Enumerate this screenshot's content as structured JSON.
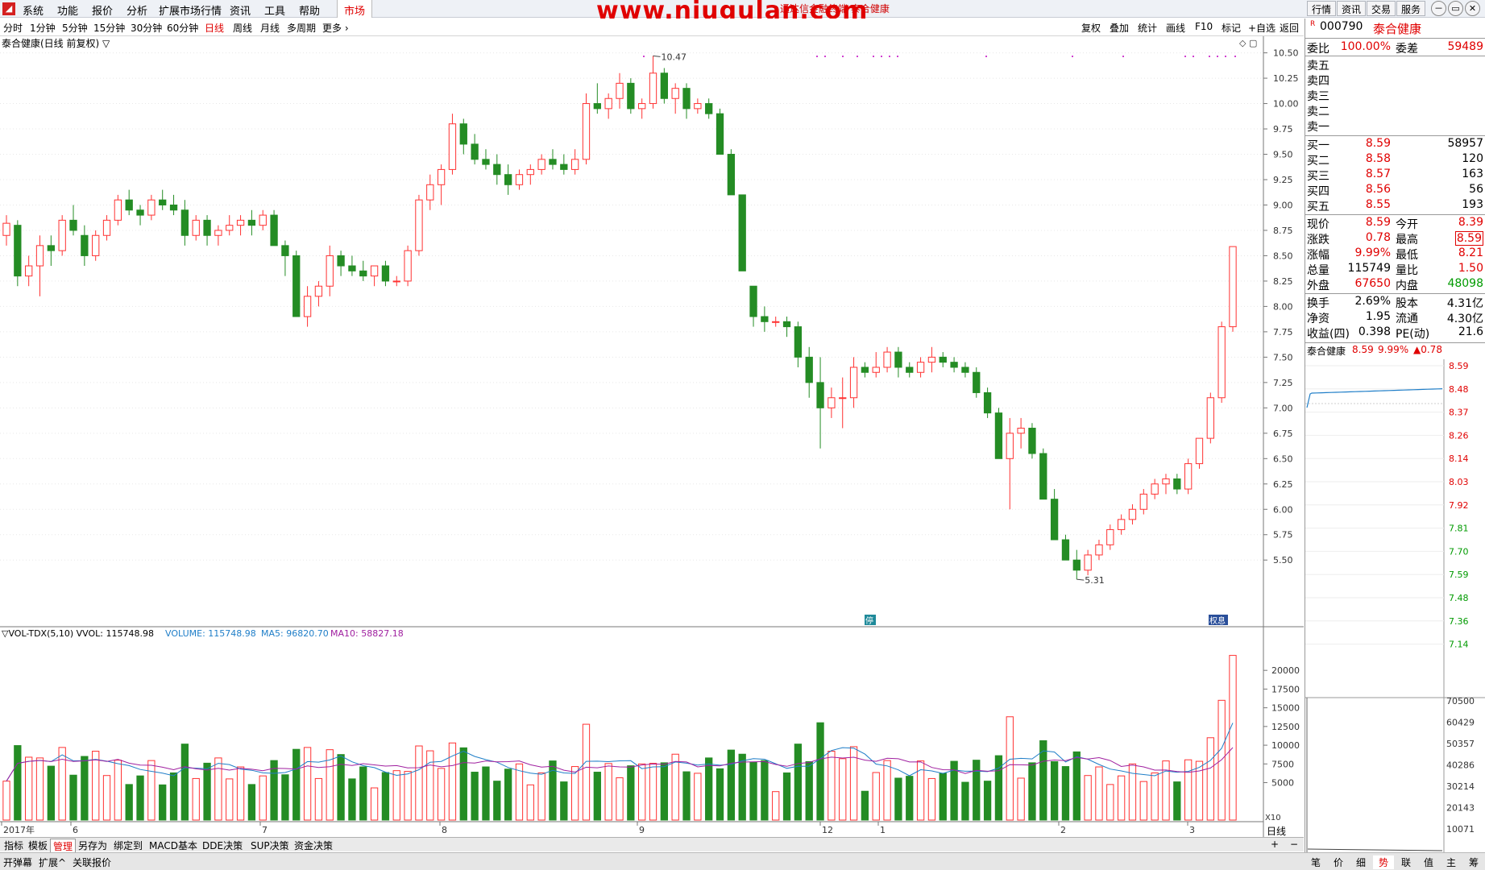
{
  "menu": [
    "系统",
    "功能",
    "报价",
    "分析",
    "扩展市场行情",
    "资讯",
    "工具",
    "帮助"
  ],
  "market_tab": "市场",
  "watermark": "www.niugulan.com",
  "window_title": "通达信金融终端 泰合健康",
  "top_buttons": [
    "行情",
    "资讯",
    "交易",
    "服务"
  ],
  "window_controls": [
    "－",
    "▭",
    "⊙",
    "✕"
  ],
  "periods": [
    "分时",
    "1分钟",
    "5分钟",
    "15分钟",
    "30分钟",
    "60分钟",
    "日线",
    "周线",
    "月线",
    "多周期",
    "更多 ›"
  ],
  "active_period": "日线",
  "tools_right": [
    "复权",
    "叠加",
    "统计",
    "画线",
    "F10",
    "标记",
    "+自选",
    "返回"
  ],
  "chart": {
    "title": "泰合健康(日线 前复权) ▽",
    "high_label": "10.47",
    "low_label": "5.31",
    "price_ticks": [
      "10.50",
      "10.25",
      "10.00",
      "9.75",
      "9.50",
      "9.25",
      "9.00",
      "8.75",
      "8.50",
      "8.25",
      "8.00",
      "7.75",
      "7.50",
      "7.25",
      "7.00",
      "6.75",
      "6.50",
      "6.25",
      "6.00",
      "5.75",
      "5.50"
    ],
    "vol_ticks": [
      "20000",
      "17500",
      "15000",
      "12500",
      "10000",
      "7500",
      "5000"
    ],
    "vol_unit": "X10",
    "vol_header_a": "▽VOL-TDX(5,10)  VVOL: 115748.98",
    "vol_header_b": "VOLUME: 115748.98",
    "vol_header_c": "MA5: 96820.70",
    "vol_header_d": "MA10: 58827.18",
    "months": [
      "2017年",
      "6",
      "7",
      "8",
      "9",
      "12",
      "1",
      "2",
      "3"
    ],
    "marker_stop": "停",
    "marker_div": "权息",
    "period_right": "日线"
  },
  "chart_data": {
    "type": "candlestick",
    "title": "泰合健康(日线 前复权)",
    "ylim": [
      5.2,
      10.6
    ],
    "annotations": {
      "high": 10.47,
      "low": 5.31
    },
    "ohlc": [
      [
        8.7,
        8.9,
        8.6,
        8.82
      ],
      [
        8.8,
        8.85,
        8.2,
        8.3
      ],
      [
        8.3,
        8.5,
        8.2,
        8.4
      ],
      [
        8.4,
        8.7,
        8.1,
        8.6
      ],
      [
        8.6,
        8.7,
        8.4,
        8.55
      ],
      [
        8.55,
        8.9,
        8.5,
        8.85
      ],
      [
        8.85,
        9.0,
        8.7,
        8.75
      ],
      [
        8.7,
        8.8,
        8.4,
        8.5
      ],
      [
        8.5,
        8.75,
        8.45,
        8.7
      ],
      [
        8.7,
        8.9,
        8.65,
        8.85
      ],
      [
        8.85,
        9.1,
        8.8,
        9.05
      ],
      [
        9.05,
        9.15,
        8.9,
        8.95
      ],
      [
        8.95,
        9.0,
        8.8,
        8.9
      ],
      [
        8.9,
        9.1,
        8.85,
        9.05
      ],
      [
        9.05,
        9.15,
        8.95,
        9.0
      ],
      [
        9.0,
        9.1,
        8.9,
        8.95
      ],
      [
        8.95,
        9.05,
        8.6,
        8.7
      ],
      [
        8.7,
        8.9,
        8.65,
        8.85
      ],
      [
        8.85,
        8.9,
        8.6,
        8.7
      ],
      [
        8.7,
        8.8,
        8.6,
        8.75
      ],
      [
        8.75,
        8.9,
        8.7,
        8.8
      ],
      [
        8.8,
        8.9,
        8.7,
        8.85
      ],
      [
        8.85,
        8.95,
        8.7,
        8.8
      ],
      [
        8.8,
        8.95,
        8.75,
        8.9
      ],
      [
        8.9,
        8.95,
        8.7,
        8.6
      ],
      [
        8.6,
        8.65,
        8.3,
        8.5
      ],
      [
        8.5,
        8.55,
        8.0,
        7.9
      ],
      [
        7.9,
        8.2,
        7.8,
        8.1
      ],
      [
        8.1,
        8.25,
        8.0,
        8.2
      ],
      [
        8.2,
        8.6,
        8.1,
        8.5
      ],
      [
        8.5,
        8.55,
        8.3,
        8.4
      ],
      [
        8.4,
        8.5,
        8.3,
        8.35
      ],
      [
        8.35,
        8.45,
        8.25,
        8.3
      ],
      [
        8.3,
        8.4,
        8.2,
        8.4
      ],
      [
        8.4,
        8.45,
        8.2,
        8.25
      ],
      [
        8.25,
        8.3,
        8.2,
        8.25
      ],
      [
        8.25,
        8.6,
        8.2,
        8.55
      ],
      [
        8.55,
        9.1,
        8.5,
        9.05
      ],
      [
        9.05,
        9.3,
        8.95,
        9.2
      ],
      [
        9.2,
        9.4,
        9.0,
        9.35
      ],
      [
        9.35,
        9.9,
        9.3,
        9.8
      ],
      [
        9.8,
        9.85,
        9.5,
        9.6
      ],
      [
        9.6,
        9.7,
        9.4,
        9.45
      ],
      [
        9.45,
        9.55,
        9.35,
        9.4
      ],
      [
        9.4,
        9.5,
        9.2,
        9.3
      ],
      [
        9.3,
        9.4,
        9.1,
        9.2
      ],
      [
        9.2,
        9.35,
        9.15,
        9.3
      ],
      [
        9.3,
        9.4,
        9.2,
        9.35
      ],
      [
        9.35,
        9.5,
        9.3,
        9.45
      ],
      [
        9.45,
        9.55,
        9.35,
        9.4
      ],
      [
        9.4,
        9.5,
        9.3,
        9.35
      ],
      [
        9.35,
        9.55,
        9.3,
        9.45
      ],
      [
        9.45,
        10.1,
        9.4,
        10.0
      ],
      [
        10.0,
        10.2,
        9.9,
        9.95
      ],
      [
        9.95,
        10.1,
        9.85,
        10.05
      ],
      [
        10.05,
        10.3,
        9.95,
        10.2
      ],
      [
        10.2,
        10.25,
        9.9,
        9.95
      ],
      [
        9.95,
        10.05,
        9.85,
        10.0
      ],
      [
        10.0,
        10.47,
        9.95,
        10.3
      ],
      [
        10.3,
        10.35,
        10.0,
        10.05
      ],
      [
        10.05,
        10.2,
        9.9,
        10.15
      ],
      [
        10.15,
        10.2,
        9.85,
        9.95
      ],
      [
        9.95,
        10.05,
        9.9,
        10.0
      ],
      [
        10.0,
        10.05,
        9.85,
        9.9
      ],
      [
        9.9,
        9.95,
        9.6,
        9.5
      ],
      [
        9.5,
        9.55,
        9.1,
        9.1
      ],
      [
        9.1,
        9.1,
        8.4,
        8.35
      ],
      [
        8.2,
        8.2,
        7.8,
        7.9
      ],
      [
        7.9,
        8.0,
        7.75,
        7.85
      ],
      [
        7.85,
        7.9,
        7.8,
        7.85
      ],
      [
        7.85,
        7.9,
        7.7,
        7.8
      ],
      [
        7.8,
        7.85,
        7.4,
        7.5
      ],
      [
        7.5,
        7.6,
        7.1,
        7.25
      ],
      [
        7.25,
        7.5,
        6.6,
        7.0
      ],
      [
        7.0,
        7.2,
        6.9,
        7.1
      ],
      [
        7.1,
        7.3,
        6.8,
        7.1
      ],
      [
        7.1,
        7.5,
        7.0,
        7.4
      ],
      [
        7.4,
        7.45,
        7.3,
        7.35
      ],
      [
        7.35,
        7.55,
        7.3,
        7.4
      ],
      [
        7.4,
        7.6,
        7.35,
        7.55
      ],
      [
        7.55,
        7.6,
        7.3,
        7.4
      ],
      [
        7.4,
        7.45,
        7.3,
        7.35
      ],
      [
        7.35,
        7.5,
        7.3,
        7.45
      ],
      [
        7.45,
        7.6,
        7.35,
        7.5
      ],
      [
        7.5,
        7.55,
        7.4,
        7.45
      ],
      [
        7.45,
        7.5,
        7.35,
        7.4
      ],
      [
        7.4,
        7.45,
        7.3,
        7.35
      ],
      [
        7.35,
        7.4,
        7.1,
        7.15
      ],
      [
        7.15,
        7.2,
        6.9,
        6.95
      ],
      [
        6.95,
        7.0,
        6.5,
        6.5
      ],
      [
        6.5,
        6.9,
        6.0,
        6.75
      ],
      [
        6.75,
        6.9,
        6.6,
        6.8
      ],
      [
        6.8,
        6.85,
        6.5,
        6.55
      ],
      [
        6.55,
        6.6,
        6.1,
        6.1
      ],
      [
        6.1,
        6.2,
        5.7,
        5.7
      ],
      [
        5.7,
        5.75,
        5.5,
        5.5
      ],
      [
        5.5,
        5.6,
        5.31,
        5.4
      ],
      [
        5.4,
        5.6,
        5.35,
        5.55
      ],
      [
        5.55,
        5.7,
        5.5,
        5.65
      ],
      [
        5.65,
        5.85,
        5.6,
        5.8
      ],
      [
        5.8,
        5.95,
        5.75,
        5.9
      ],
      [
        5.9,
        6.05,
        5.85,
        6.0
      ],
      [
        6.0,
        6.2,
        5.95,
        6.15
      ],
      [
        6.15,
        6.3,
        6.1,
        6.25
      ],
      [
        6.25,
        6.35,
        6.15,
        6.3
      ],
      [
        6.3,
        6.35,
        6.15,
        6.2
      ],
      [
        6.2,
        6.5,
        6.15,
        6.45
      ],
      [
        6.45,
        6.55,
        6.4,
        6.7
      ],
      [
        6.7,
        7.15,
        6.65,
        7.1
      ],
      [
        7.1,
        7.85,
        7.05,
        7.8
      ],
      [
        7.8,
        8.59,
        7.75,
        8.59
      ]
    ],
    "volume_ticks": [
      20000,
      17500,
      15000,
      12500,
      10000,
      7500,
      5000
    ],
    "series": [
      {
        "name": "VOLUME",
        "latest": 115748.98
      },
      {
        "name": "MA5",
        "latest": 96820.7
      },
      {
        "name": "MA10",
        "latest": 58827.18
      }
    ]
  },
  "orderbook": {
    "weibi_label": "委比",
    "weibi": "100.00%",
    "weicha_label": "委差",
    "weicha": "59489",
    "sells": [
      "卖五",
      "卖四",
      "卖三",
      "卖二",
      "卖一"
    ],
    "buys": [
      {
        "label": "买一",
        "price": "8.59",
        "vol": "58957"
      },
      {
        "label": "买二",
        "price": "8.58",
        "vol": "120"
      },
      {
        "label": "买三",
        "price": "8.57",
        "vol": "163"
      },
      {
        "label": "买四",
        "price": "8.56",
        "vol": "56"
      },
      {
        "label": "买五",
        "price": "8.55",
        "vol": "193"
      }
    ]
  },
  "stock": {
    "code": "000790",
    "name": "泰合健康",
    "flag": "R"
  },
  "quote": [
    {
      "l": "现价",
      "v": "8.59",
      "l2": "今开",
      "v2": "8.39",
      "red2": true
    },
    {
      "l": "涨跌",
      "v": "0.78",
      "l2": "最高",
      "v2": "8.59",
      "red2": true
    },
    {
      "l": "涨幅",
      "v": "9.99%",
      "l2": "最低",
      "v2": "8.21",
      "red2": true
    },
    {
      "l": "总量",
      "v": "115749",
      "l2": "量比",
      "v2": "1.50",
      "red2": true,
      "black1": true
    },
    {
      "l": "外盘",
      "v": "67650",
      "l2": "内盘",
      "v2": "48098",
      "red2": false
    },
    {
      "l": "换手",
      "v": "2.69%",
      "l2": "股本",
      "v2": "4.31亿",
      "red2": false,
      "black1": true
    },
    {
      "l": "净资",
      "v": "1.95",
      "l2": "流通",
      "v2": "4.30亿",
      "red2": false,
      "black1": true
    },
    {
      "l": "收益(四)",
      "v": "0.398",
      "l2": "PE(动)",
      "v2": "21.6",
      "red2": false,
      "black1": true
    }
  ],
  "mini": {
    "name": "泰合健康",
    "price": "8.59",
    "pct": "9.99%",
    "chg": "▲0.78",
    "price_ticks": [
      "8.59",
      "8.48",
      "8.37",
      "8.26",
      "8.14",
      "8.03",
      "7.92",
      "7.81",
      "7.70",
      "7.59",
      "7.48",
      "7.36",
      "7.14"
    ],
    "vol_ticks": [
      "70500",
      "60429",
      "50357",
      "40286",
      "30214",
      "20143",
      "10071"
    ]
  },
  "bottom_tabs": [
    "指标",
    "模板",
    "管理",
    "另存为",
    "绑定到",
    "MACD基本",
    "DDE决策",
    "SUP决策",
    "资金决策"
  ],
  "bottom_right": [
    "+",
    "−"
  ],
  "status_left": [
    "开弹幕",
    "扩展^",
    "关联报价"
  ],
  "status_right": [
    "笔",
    "价",
    "细",
    "势",
    "联",
    "值",
    "主",
    "筹"
  ]
}
